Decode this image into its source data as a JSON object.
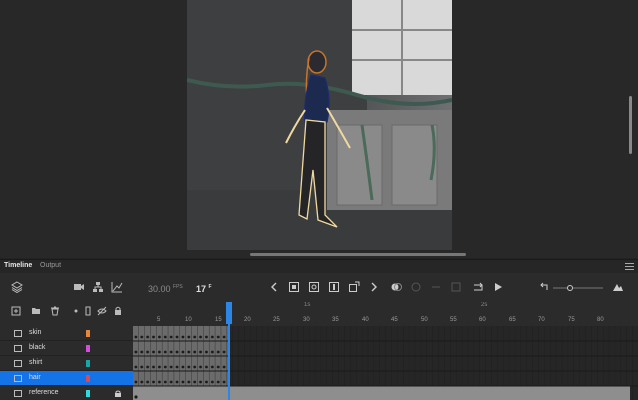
{
  "timeline": {
    "tabs": [
      "Timeline",
      "Output"
    ],
    "fps": "30.00",
    "fps_unit": "FPS",
    "current_frame": "17",
    "current_frame_unit": "F"
  },
  "ruler": {
    "seconds": [
      "1s",
      "2s"
    ],
    "frame_labels": [
      "5",
      "10",
      "15",
      "20",
      "25",
      "30",
      "35",
      "40",
      "45",
      "50",
      "55",
      "60",
      "65",
      "70",
      "75",
      "80"
    ]
  },
  "layers": [
    {
      "name": "skin",
      "color": "#e8873a",
      "selected": false,
      "locked": false
    },
    {
      "name": "black",
      "color": "#d949e0",
      "selected": false,
      "locked": false
    },
    {
      "name": "shirt",
      "color": "#18a6a6",
      "selected": false,
      "locked": false
    },
    {
      "name": "hair",
      "color": "#d9495a",
      "selected": true,
      "locked": false
    },
    {
      "name": "reference",
      "color": "#2fd9e0",
      "selected": false,
      "locked": true
    }
  ],
  "colors": {
    "accent": "#1473e6",
    "playhead": "#2d86e6"
  },
  "icons": {
    "toolbar": [
      "layers-icon",
      "camera-icon",
      "layer-hierarchy-icon",
      "graph-icon",
      "prev-keyframe-icon",
      "insert-keyframe-icon",
      "insert-blank-keyframe-icon",
      "clear-keyframe-icon",
      "tween-icon",
      "next-keyframe-icon",
      "onion-skin-icon",
      "loop-icon",
      "play-icon",
      "zoom-out-icon",
      "zoom-in-icon"
    ],
    "layer_header": [
      "new-layer-icon",
      "new-folder-icon",
      "delete-icon",
      "highlight-icon",
      "outline-icon",
      "visibility-icon",
      "lock-icon"
    ]
  }
}
